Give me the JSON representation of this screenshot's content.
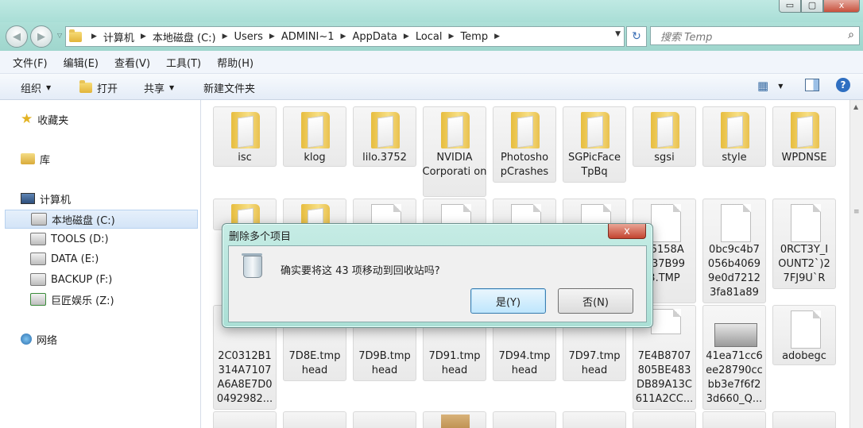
{
  "window": {
    "controls": {
      "minimize": "▭",
      "maximize": "▢",
      "close": "x"
    }
  },
  "address": {
    "crumbs": [
      "计算机",
      "本地磁盘 (C:)",
      "Users",
      "ADMINI~1",
      "AppData",
      "Local",
      "Temp"
    ],
    "search_placeholder": "搜索 Temp"
  },
  "menu": [
    "文件(F)",
    "编辑(E)",
    "查看(V)",
    "工具(T)",
    "帮助(H)"
  ],
  "commands": {
    "organize": "组织",
    "open": "打开",
    "share": "共享",
    "new_folder": "新建文件夹"
  },
  "sidebar": {
    "favorites": "收藏夹",
    "libraries": "库",
    "computer": "计算机",
    "drives": [
      "本地磁盘 (C:)",
      "TOOLS (D:)",
      "DATA (E:)",
      "BACKUP (F:)",
      "巨匠娱乐 (Z:)"
    ],
    "network": "网络"
  },
  "files": {
    "row1": [
      "isc",
      "klog",
      "lilo.3752",
      "NVIDIA Corporati on",
      "Photosho pCrashes",
      "SGPicFace TpBq",
      "sgsi",
      "style",
      "WPDNSE"
    ],
    "row2": [
      "F5158A D37B99 3.TMP",
      "0bc9c4b7 056b4069 9e0d7212 3fa81a89",
      "0RCT3Y_I OUNT2`)2 7FJ9U`R"
    ],
    "row3": [
      "2C0312B1 314A7107 A6A8E7D0 0492982...",
      "7D8E.tmp head",
      "7D9B.tmp head",
      "7D91.tmp head",
      "7D94.tmp head",
      "7D97.tmp head",
      "7E4B8707 805BE483 DB89A13C 611A2CC...",
      "41ea71cc6 ee28790cc bb3e7f6f2 3d660_Q...",
      "adobegc"
    ]
  },
  "dialog": {
    "title": "删除多个项目",
    "message": "确实要将这 43 项移动到回收站吗?",
    "yes": "是(Y)",
    "no": "否(N)",
    "close": "x"
  }
}
